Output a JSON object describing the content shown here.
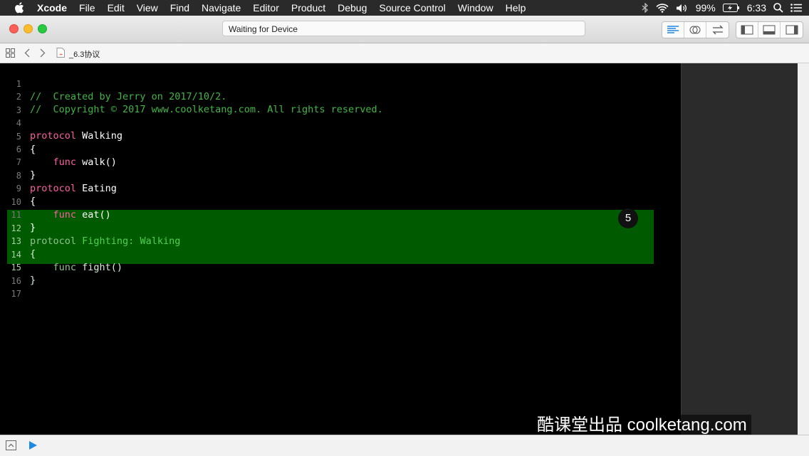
{
  "menubar": {
    "app_name": "Xcode",
    "items": [
      "File",
      "Edit",
      "View",
      "Find",
      "Navigate",
      "Editor",
      "Product",
      "Debug",
      "Source Control",
      "Window",
      "Help"
    ],
    "battery": "99%",
    "time": "6:33"
  },
  "toolbar": {
    "status": "Waiting for Device"
  },
  "jumpbar": {
    "file_name": "_6.3协议"
  },
  "editor": {
    "lines": [
      {
        "n": "1",
        "text": "//  Created by Jerry on 2017/10/2."
      },
      {
        "n": "2",
        "text": "//  Copyright © 2017 www.coolketang.com. All rights reserved."
      },
      {
        "n": "3",
        "text": ""
      },
      {
        "n": "4",
        "kw": "protocol",
        "rest": " Walking"
      },
      {
        "n": "5",
        "text": "{"
      },
      {
        "n": "6",
        "kw": "    func",
        "rest": " walk()"
      },
      {
        "n": "7",
        "text": "}"
      },
      {
        "n": "8",
        "kw": "protocol",
        "rest": " Eating"
      },
      {
        "n": "9",
        "text": "{"
      },
      {
        "n": "10",
        "kw": "    func",
        "rest": " eat()"
      },
      {
        "n": "11",
        "text": "}"
      },
      {
        "n": "12",
        "kw": "protocol",
        "type1": " Fighting:",
        "type2": " Walking"
      },
      {
        "n": "13",
        "text": "{"
      },
      {
        "n": "14",
        "kw": "    func",
        "rest": " fight()"
      },
      {
        "n": "15",
        "text": "}"
      },
      {
        "n": "16",
        "text": ""
      },
      {
        "n": "17",
        "text": ""
      }
    ],
    "badge": "5"
  },
  "watermark": "酷课堂出品 coolketang.com",
  "colors": {
    "comment": "#41b645",
    "keyword": "#fc5fa3",
    "highlight": "#005a00"
  }
}
